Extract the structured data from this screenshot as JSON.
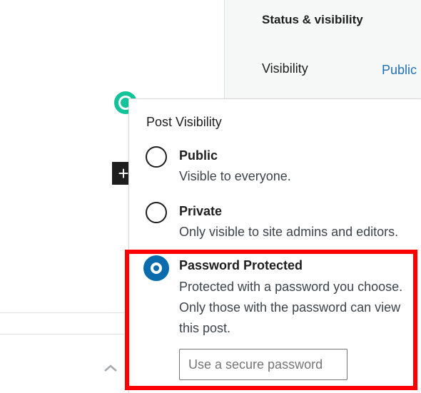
{
  "sidebar": {
    "panel_title": "Status & visibility",
    "visibility_label": "Visibility",
    "visibility_value": "Public"
  },
  "popover": {
    "title": "Post Visibility",
    "options": [
      {
        "label": "Public",
        "description": "Visible to everyone.",
        "selected": false
      },
      {
        "label": "Private",
        "description": "Only visible to site admins and editors.",
        "selected": false
      },
      {
        "label": "Password Protected",
        "description": "Protected with a password you choose. Only those with the password can view this post.",
        "selected": true
      }
    ],
    "password": {
      "value": "",
      "placeholder": "Use a secure password"
    }
  },
  "icons": {
    "add_block": "plus-icon",
    "collapse": "chevron-up-icon",
    "grammarly": "grammarly-icon"
  },
  "colors": {
    "accent": "#0a6cad",
    "link": "#2271b1",
    "highlight": "#ff0000",
    "grammarly": "#15c39a"
  }
}
